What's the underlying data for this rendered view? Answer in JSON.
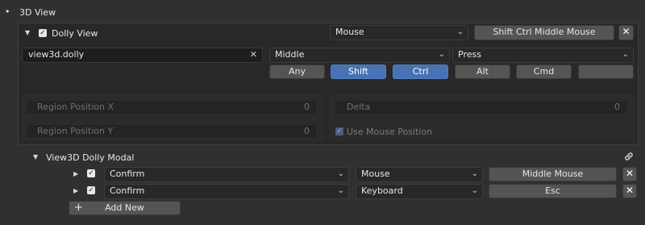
{
  "section": {
    "bullet": "•",
    "title": "3D View"
  },
  "keymap_item": {
    "expand_icon": "triangle-down-icon",
    "name": "Dolly View",
    "checked": true,
    "input_type": "Mouse",
    "shortcut": "Shift Ctrl Middle Mouse",
    "remove_icon": "close-icon",
    "remove_glyph": "✕",
    "operator_id": "view3d.dolly",
    "clear_glyph": "✕",
    "button": "Middle",
    "event": "Press",
    "modifiers": [
      {
        "label": "Any",
        "active": false
      },
      {
        "label": "Shift",
        "active": true
      },
      {
        "label": "Ctrl",
        "active": true
      },
      {
        "label": "Alt",
        "active": false
      },
      {
        "label": "Cmd",
        "active": false
      },
      {
        "label": "",
        "active": false
      }
    ],
    "properties": {
      "region_x_label": "Region Position X",
      "region_x_value": "0",
      "region_y_label": "Region Position Y",
      "region_y_value": "0",
      "delta_label": "Delta",
      "delta_value": "0",
      "use_mouse_label": "Use Mouse Position",
      "use_mouse_checked": true
    }
  },
  "modal": {
    "title": "View3D Dolly Modal",
    "link_icon": "link-icon",
    "items": [
      {
        "action": "Confirm",
        "input_type": "Mouse",
        "key": "Middle Mouse",
        "checked": true,
        "remove_glyph": "✕"
      },
      {
        "action": "Confirm",
        "input_type": "Keyboard",
        "key": "Esc",
        "checked": true,
        "remove_glyph": "✕"
      }
    ],
    "add_new_glyph": "+",
    "add_new_label": "Add New"
  },
  "colors": {
    "background": "#303030",
    "accent": "#4772b3",
    "button": "#545454",
    "field": "#1d1d1d"
  }
}
